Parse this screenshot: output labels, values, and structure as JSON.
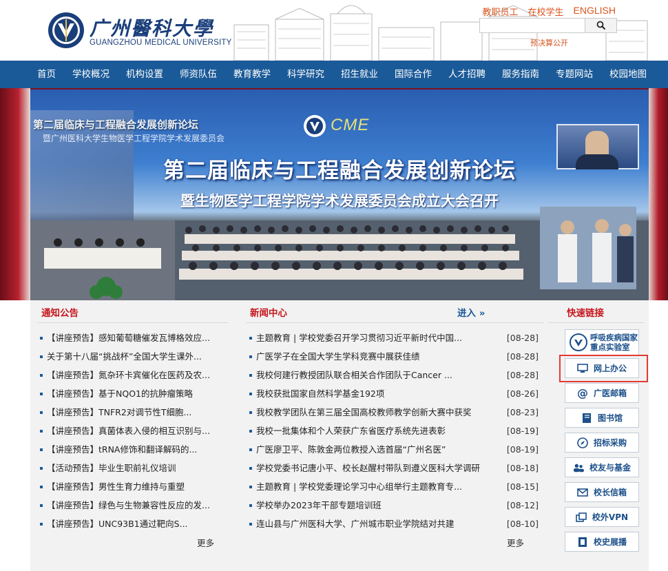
{
  "header": {
    "logo_cn": "广州醫科大學",
    "logo_en": "GUANGZHOU MEDICAL UNIVERSITY",
    "top_links": [
      "教职员工",
      "在校学生",
      "ENGLISH"
    ],
    "search_placeholder": "",
    "fraud_notice": "预决算公开"
  },
  "nav": {
    "items": [
      "首页",
      "学校概况",
      "机构设置",
      "师资队伍",
      "教育教学",
      "科学研究",
      "招生就业",
      "国际合作",
      "人才招聘",
      "服务指南",
      "专题网站",
      "校园地图"
    ]
  },
  "banner": {
    "brand": "CME",
    "title": "第二届临床与工程融合发展创新论坛",
    "subtitle": "暨生物医学工程学院学术发展委员会成立大会召开",
    "left_caption": "第二届临床与工程融合发展创新论坛",
    "left_caption2": "暨广州医科大学生物医学工程学院学术发展委员会"
  },
  "notice": {
    "title": "通知公告",
    "items": [
      "【讲座预告】感知葡萄糖催发瓦博格效应...",
      "关于第十八届“挑战杯”全国大学生课外...",
      "【讲座预告】氮杂环卡宾催化在医药及农...",
      "【讲座预告】基于NQO1的抗肿瘤策略",
      "【讲座预告】TNFR2对调节性T细胞...",
      "【讲座预告】真菌体表入侵的相互识别与...",
      "【讲座预告】tRNA修饰和翻译解码的...",
      "【活动预告】毕业生职前礼仪培训",
      "【讲座预告】男性生育力维持与重塑",
      "【讲座预告】绿色与生物兼容性反应的发...",
      "【讲座预告】UNC93B1通过靶向S..."
    ],
    "more": "更多"
  },
  "news": {
    "title": "新闻中心",
    "enter": "进入 »",
    "items": [
      {
        "text": "主题教育 | 学校党委召开学习贯彻习近平新时代中国...",
        "date": "[08-28]"
      },
      {
        "text": "广医学子在全国大学生学科竞赛中展获佳绩",
        "date": "[08-28]"
      },
      {
        "text": "我校何建行教授团队联合相关合作团队于Cancer ...",
        "date": "[08-28]"
      },
      {
        "text": "我校获批国家自然科学基金192项",
        "date": "[08-26]"
      },
      {
        "text": "我校教学团队在第三届全国高校教师教学创新大赛中获奖",
        "date": "[08-23]"
      },
      {
        "text": "我校一批集体和个人荣获广东省医疗系统先进表彰",
        "date": "[08-19]"
      },
      {
        "text": "广医廖卫平、陈敦金两位教授入选首届“广州名医”",
        "date": "[08-19]"
      },
      {
        "text": "学校党委书记唐小平、校长赵醒村带队到遵义医科大学调研",
        "date": "[08-18]"
      },
      {
        "text": "主题教育 | 学校党委理论学习中心组举行主题教育专...",
        "date": "[08-15]"
      },
      {
        "text": "学校举办2023年干部专题培训班",
        "date": "[08-12]"
      },
      {
        "text": "连山县与广州医科大学、广州城市职业学院结对共建",
        "date": "[08-10]"
      }
    ],
    "more": "更多"
  },
  "quick": {
    "title": "快速链接",
    "lab_line1": "呼吸疾病国家",
    "lab_line2": "重点实验室",
    "buttons": [
      {
        "label": "网上办公",
        "icon": "monitor-icon"
      },
      {
        "label": "广医邮箱",
        "icon": "at-icon"
      },
      {
        "label": "图书馆",
        "icon": "book-icon"
      },
      {
        "label": "招标采购",
        "icon": "compass-icon"
      },
      {
        "label": "校友与基金",
        "icon": "people-icon"
      },
      {
        "label": "校长信箱",
        "icon": "mail-icon"
      },
      {
        "label": "校外VPN",
        "icon": "windows-icon"
      },
      {
        "label": "校史展播",
        "icon": "film-icon"
      }
    ]
  },
  "colors": {
    "nav_blue": "#1b5a98",
    "accent_red": "#c6161d",
    "link_orange": "#d9541e",
    "highlight": "#e33a33"
  }
}
